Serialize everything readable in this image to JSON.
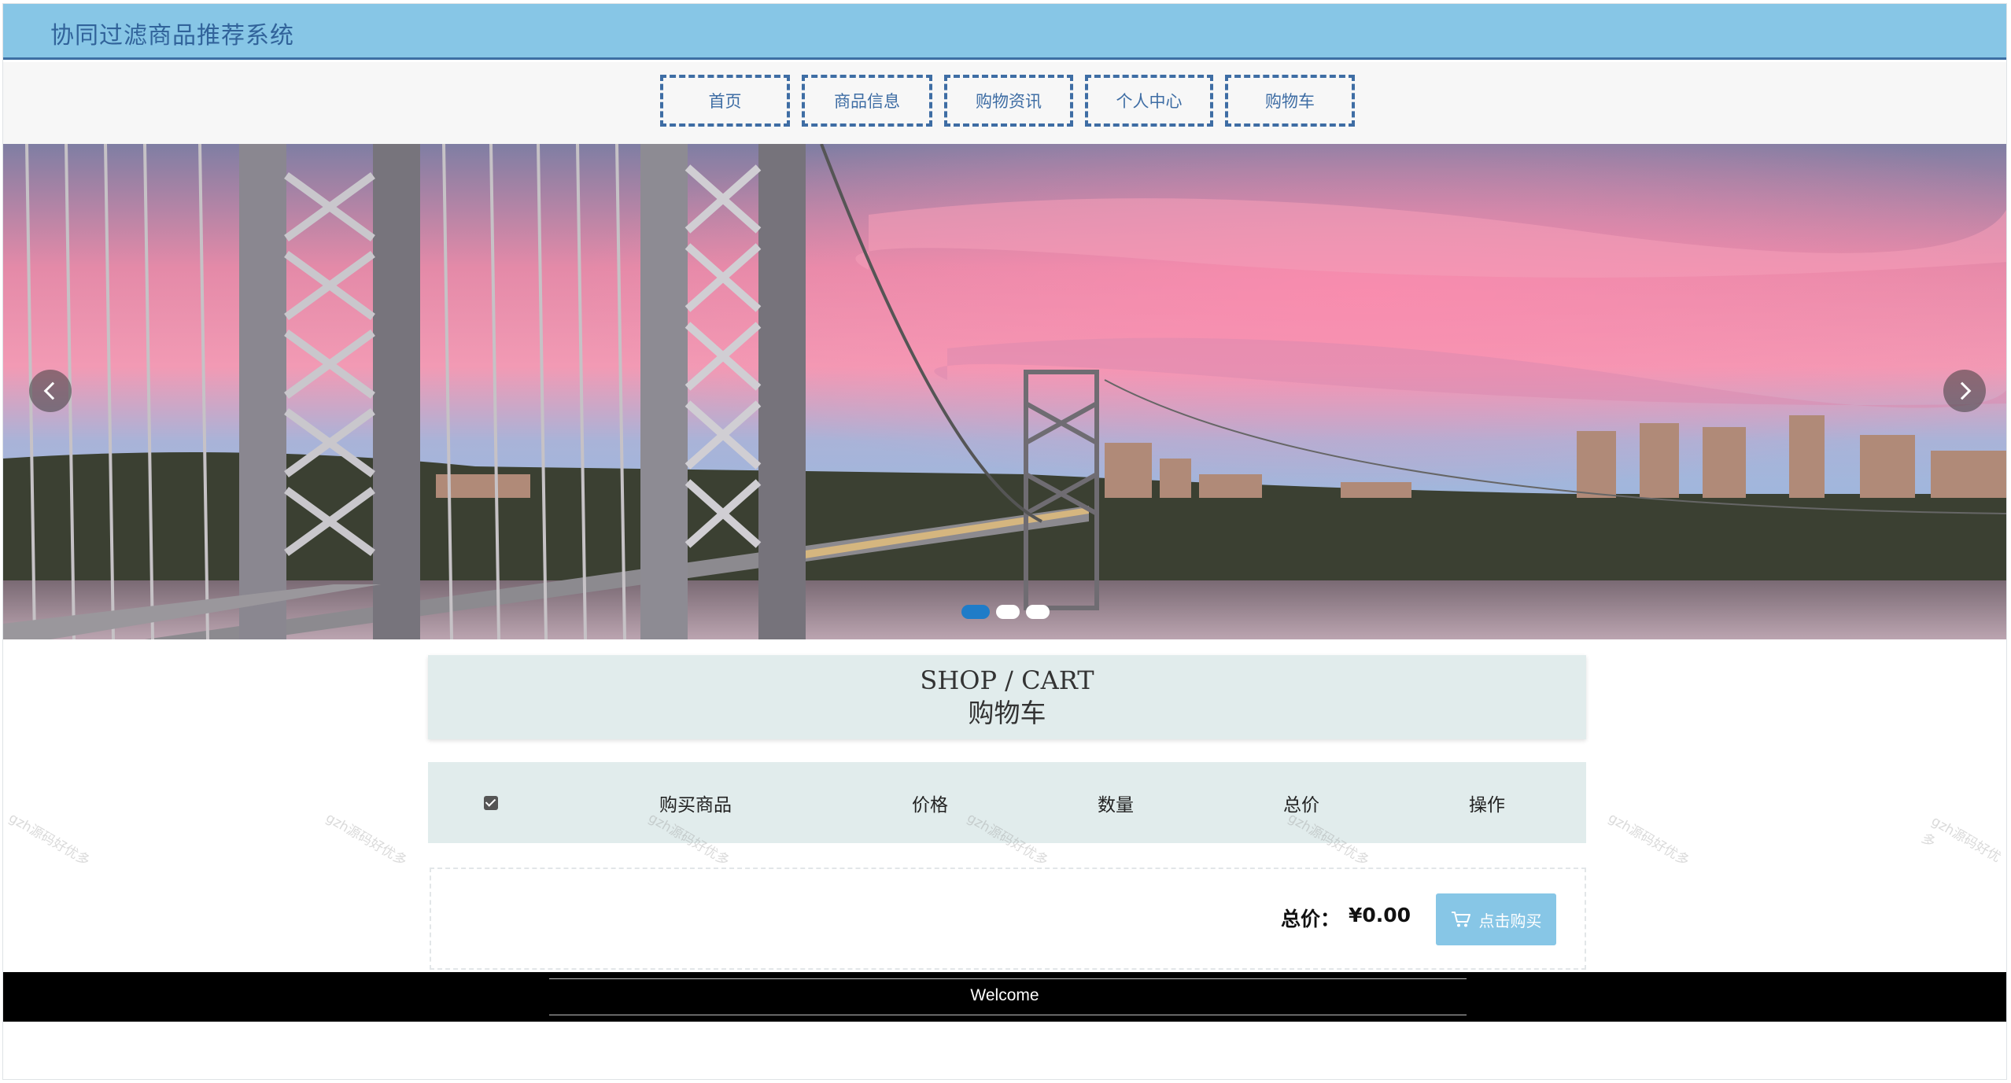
{
  "header": {
    "title": "协同过滤商品推荐系统"
  },
  "nav": {
    "items": [
      {
        "label": "首页"
      },
      {
        "label": "商品信息"
      },
      {
        "label": "购物资讯"
      },
      {
        "label": "个人中心"
      },
      {
        "label": "购物车"
      }
    ]
  },
  "carousel": {
    "slide_count": 3,
    "active_index": 0
  },
  "section": {
    "title_en": "SHOP / CART",
    "title_cn": "购物车"
  },
  "cart": {
    "columns": [
      "购买商品",
      "价格",
      "数量",
      "总价",
      "操作"
    ],
    "select_all_checked": true,
    "rows": [],
    "total_label": "总价：",
    "total_value": "¥0.00",
    "buy_label": "点击购买"
  },
  "footer": {
    "text": "Welcome"
  },
  "watermark": "gzh源码好优多",
  "colors": {
    "topbar": "#87c6e6",
    "nav_border": "#3e6da4",
    "section_bg": "#e1ecec",
    "footer": "#000000"
  }
}
